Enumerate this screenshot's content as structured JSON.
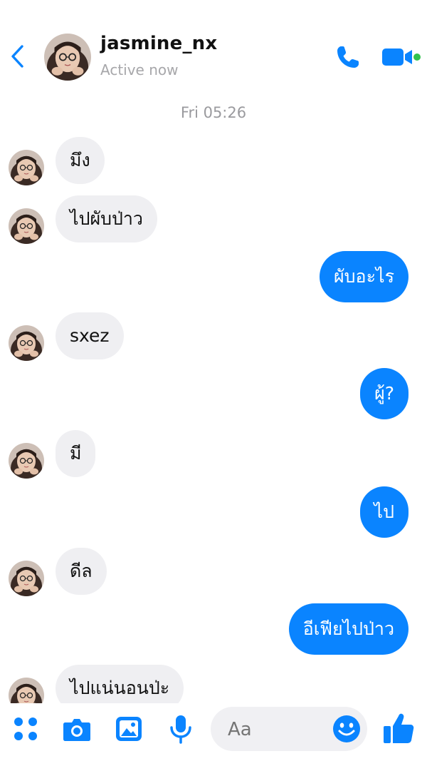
{
  "header": {
    "name": "jasmine_nx",
    "status": "Active now",
    "back_icon": "chevron-left-icon",
    "call_icon": "phone-icon",
    "video_icon": "video-camera-icon"
  },
  "conversation": {
    "timestamp": "Fri 05:26",
    "messages": [
      {
        "from": "them",
        "text": "มึง"
      },
      {
        "from": "them",
        "text": "ไปผับป่าว"
      },
      {
        "from": "me",
        "text": "ผับอะไร"
      },
      {
        "from": "them",
        "text": "sxez"
      },
      {
        "from": "me",
        "text": "ผู้?"
      },
      {
        "from": "them",
        "text": "มี"
      },
      {
        "from": "me",
        "text": "ไป"
      },
      {
        "from": "them",
        "text": "ดีล"
      },
      {
        "from": "me",
        "text": "อีเฟียไปป่าว"
      },
      {
        "from": "them",
        "text": "ไปแน่นอนป่ะ"
      }
    ]
  },
  "composer": {
    "placeholder": "Aa",
    "icons": [
      "apps-grid-icon",
      "camera-icon",
      "gallery-icon",
      "microphone-icon",
      "emoji-icon",
      "thumbs-up-icon"
    ]
  },
  "colors": {
    "accent": "#0a84ff",
    "incoming_bubble": "#efeff2",
    "online_dot": "#31c24d"
  }
}
